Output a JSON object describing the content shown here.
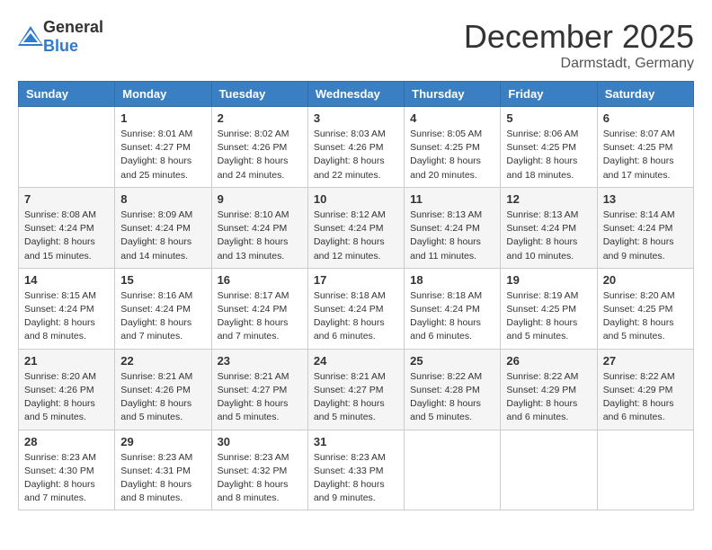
{
  "header": {
    "logo_general": "General",
    "logo_blue": "Blue",
    "month_title": "December 2025",
    "location": "Darmstadt, Germany"
  },
  "weekdays": [
    "Sunday",
    "Monday",
    "Tuesday",
    "Wednesday",
    "Thursday",
    "Friday",
    "Saturday"
  ],
  "weeks": [
    [
      {
        "day": "",
        "sunrise": "",
        "sunset": "",
        "daylight": ""
      },
      {
        "day": "1",
        "sunrise": "Sunrise: 8:01 AM",
        "sunset": "Sunset: 4:27 PM",
        "daylight": "Daylight: 8 hours and 25 minutes."
      },
      {
        "day": "2",
        "sunrise": "Sunrise: 8:02 AM",
        "sunset": "Sunset: 4:26 PM",
        "daylight": "Daylight: 8 hours and 24 minutes."
      },
      {
        "day": "3",
        "sunrise": "Sunrise: 8:03 AM",
        "sunset": "Sunset: 4:26 PM",
        "daylight": "Daylight: 8 hours and 22 minutes."
      },
      {
        "day": "4",
        "sunrise": "Sunrise: 8:05 AM",
        "sunset": "Sunset: 4:25 PM",
        "daylight": "Daylight: 8 hours and 20 minutes."
      },
      {
        "day": "5",
        "sunrise": "Sunrise: 8:06 AM",
        "sunset": "Sunset: 4:25 PM",
        "daylight": "Daylight: 8 hours and 18 minutes."
      },
      {
        "day": "6",
        "sunrise": "Sunrise: 8:07 AM",
        "sunset": "Sunset: 4:25 PM",
        "daylight": "Daylight: 8 hours and 17 minutes."
      }
    ],
    [
      {
        "day": "7",
        "sunrise": "Sunrise: 8:08 AM",
        "sunset": "Sunset: 4:24 PM",
        "daylight": "Daylight: 8 hours and 15 minutes."
      },
      {
        "day": "8",
        "sunrise": "Sunrise: 8:09 AM",
        "sunset": "Sunset: 4:24 PM",
        "daylight": "Daylight: 8 hours and 14 minutes."
      },
      {
        "day": "9",
        "sunrise": "Sunrise: 8:10 AM",
        "sunset": "Sunset: 4:24 PM",
        "daylight": "Daylight: 8 hours and 13 minutes."
      },
      {
        "day": "10",
        "sunrise": "Sunrise: 8:12 AM",
        "sunset": "Sunset: 4:24 PM",
        "daylight": "Daylight: 8 hours and 12 minutes."
      },
      {
        "day": "11",
        "sunrise": "Sunrise: 8:13 AM",
        "sunset": "Sunset: 4:24 PM",
        "daylight": "Daylight: 8 hours and 11 minutes."
      },
      {
        "day": "12",
        "sunrise": "Sunrise: 8:13 AM",
        "sunset": "Sunset: 4:24 PM",
        "daylight": "Daylight: 8 hours and 10 minutes."
      },
      {
        "day": "13",
        "sunrise": "Sunrise: 8:14 AM",
        "sunset": "Sunset: 4:24 PM",
        "daylight": "Daylight: 8 hours and 9 minutes."
      }
    ],
    [
      {
        "day": "14",
        "sunrise": "Sunrise: 8:15 AM",
        "sunset": "Sunset: 4:24 PM",
        "daylight": "Daylight: 8 hours and 8 minutes."
      },
      {
        "day": "15",
        "sunrise": "Sunrise: 8:16 AM",
        "sunset": "Sunset: 4:24 PM",
        "daylight": "Daylight: 8 hours and 7 minutes."
      },
      {
        "day": "16",
        "sunrise": "Sunrise: 8:17 AM",
        "sunset": "Sunset: 4:24 PM",
        "daylight": "Daylight: 8 hours and 7 minutes."
      },
      {
        "day": "17",
        "sunrise": "Sunrise: 8:18 AM",
        "sunset": "Sunset: 4:24 PM",
        "daylight": "Daylight: 8 hours and 6 minutes."
      },
      {
        "day": "18",
        "sunrise": "Sunrise: 8:18 AM",
        "sunset": "Sunset: 4:24 PM",
        "daylight": "Daylight: 8 hours and 6 minutes."
      },
      {
        "day": "19",
        "sunrise": "Sunrise: 8:19 AM",
        "sunset": "Sunset: 4:25 PM",
        "daylight": "Daylight: 8 hours and 5 minutes."
      },
      {
        "day": "20",
        "sunrise": "Sunrise: 8:20 AM",
        "sunset": "Sunset: 4:25 PM",
        "daylight": "Daylight: 8 hours and 5 minutes."
      }
    ],
    [
      {
        "day": "21",
        "sunrise": "Sunrise: 8:20 AM",
        "sunset": "Sunset: 4:26 PM",
        "daylight": "Daylight: 8 hours and 5 minutes."
      },
      {
        "day": "22",
        "sunrise": "Sunrise: 8:21 AM",
        "sunset": "Sunset: 4:26 PM",
        "daylight": "Daylight: 8 hours and 5 minutes."
      },
      {
        "day": "23",
        "sunrise": "Sunrise: 8:21 AM",
        "sunset": "Sunset: 4:27 PM",
        "daylight": "Daylight: 8 hours and 5 minutes."
      },
      {
        "day": "24",
        "sunrise": "Sunrise: 8:21 AM",
        "sunset": "Sunset: 4:27 PM",
        "daylight": "Daylight: 8 hours and 5 minutes."
      },
      {
        "day": "25",
        "sunrise": "Sunrise: 8:22 AM",
        "sunset": "Sunset: 4:28 PM",
        "daylight": "Daylight: 8 hours and 5 minutes."
      },
      {
        "day": "26",
        "sunrise": "Sunrise: 8:22 AM",
        "sunset": "Sunset: 4:29 PM",
        "daylight": "Daylight: 8 hours and 6 minutes."
      },
      {
        "day": "27",
        "sunrise": "Sunrise: 8:22 AM",
        "sunset": "Sunset: 4:29 PM",
        "daylight": "Daylight: 8 hours and 6 minutes."
      }
    ],
    [
      {
        "day": "28",
        "sunrise": "Sunrise: 8:23 AM",
        "sunset": "Sunset: 4:30 PM",
        "daylight": "Daylight: 8 hours and 7 minutes."
      },
      {
        "day": "29",
        "sunrise": "Sunrise: 8:23 AM",
        "sunset": "Sunset: 4:31 PM",
        "daylight": "Daylight: 8 hours and 8 minutes."
      },
      {
        "day": "30",
        "sunrise": "Sunrise: 8:23 AM",
        "sunset": "Sunset: 4:32 PM",
        "daylight": "Daylight: 8 hours and 8 minutes."
      },
      {
        "day": "31",
        "sunrise": "Sunrise: 8:23 AM",
        "sunset": "Sunset: 4:33 PM",
        "daylight": "Daylight: 8 hours and 9 minutes."
      },
      {
        "day": "",
        "sunrise": "",
        "sunset": "",
        "daylight": ""
      },
      {
        "day": "",
        "sunrise": "",
        "sunset": "",
        "daylight": ""
      },
      {
        "day": "",
        "sunrise": "",
        "sunset": "",
        "daylight": ""
      }
    ]
  ]
}
